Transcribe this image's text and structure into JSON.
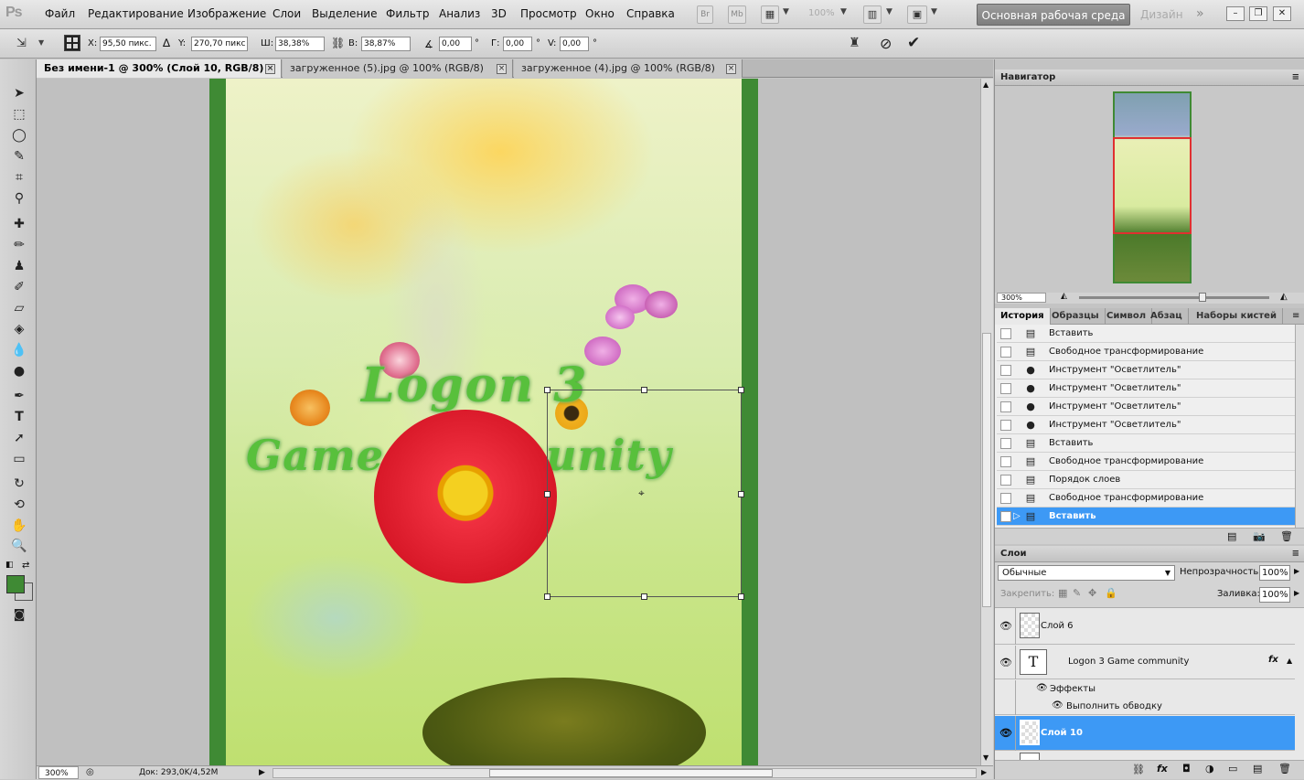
{
  "app": {
    "logo": "Ps"
  },
  "menu": [
    "Файл",
    "Редактирование",
    "Изображение",
    "Слои",
    "Выделение",
    "Фильтр",
    "Анализ",
    "3D",
    "Просмотр",
    "Окно",
    "Справка"
  ],
  "appbar": {
    "zoom": "100%",
    "bridge": "Br",
    "minibridge": "Mb",
    "workspace": "Основная рабочая среда",
    "design": "Дизайн",
    "more": "»"
  },
  "options": {
    "x_label": "X:",
    "x_value": "95,50 пикс.",
    "y_label": "Y:",
    "y_value": "270,70 пикс",
    "w_label": "Ш:",
    "w_value": "38,38%",
    "h_label": "В:",
    "h_value": "38,87%",
    "angle_value": "0,00",
    "angle_unit": "°",
    "hskew_label": "Г:",
    "hskew_value": "0,00",
    "hskew_unit": "°",
    "vskew_label": "V:",
    "vskew_value": "0,00",
    "vskew_unit": "°"
  },
  "tabs": [
    {
      "label": "Без имени-1 @ 300% (Слой 10, RGB/8) *",
      "active": true
    },
    {
      "label": "загруженное (5).jpg @ 100% (RGB/8)",
      "active": false
    },
    {
      "label": "загруженное (4).jpg @ 100% (RGB/8)",
      "active": false
    }
  ],
  "canvas": {
    "line1": "Logon 3",
    "line2": "Game community"
  },
  "status": {
    "zoom": "300%",
    "doc": "Док: 293,0K/4,52M"
  },
  "navigator": {
    "title": "Навигатор",
    "zoom": "300%"
  },
  "history_tabs": [
    "История",
    "Образцы",
    "Символ",
    "Абзац",
    "Наборы кистей"
  ],
  "history": [
    {
      "label": "Вставить",
      "icon": "doc-icon"
    },
    {
      "label": "Свободное трансформирование",
      "icon": "doc-icon"
    },
    {
      "label": "Инструмент \"Осветлитель\"",
      "icon": "dodge-icon"
    },
    {
      "label": "Инструмент \"Осветлитель\"",
      "icon": "dodge-icon"
    },
    {
      "label": "Инструмент \"Осветлитель\"",
      "icon": "dodge-icon"
    },
    {
      "label": "Инструмент \"Осветлитель\"",
      "icon": "dodge-icon"
    },
    {
      "label": "Вставить",
      "icon": "doc-icon"
    },
    {
      "label": "Свободное трансформирование",
      "icon": "doc-icon"
    },
    {
      "label": "Порядок слоев",
      "icon": "doc-icon"
    },
    {
      "label": "Свободное трансформирование",
      "icon": "doc-icon"
    },
    {
      "label": "Вставить",
      "icon": "doc-icon",
      "selected": true
    }
  ],
  "layers": {
    "title": "Слои",
    "blend_mode": "Обычные",
    "opacity_label": "Непрозрачность:",
    "opacity": "100%",
    "lock_label": "Закрепить:",
    "fill_label": "Заливка:",
    "fill": "100%",
    "items": [
      {
        "name": "Слой 6",
        "type": "raster"
      },
      {
        "name": "Logon 3  Game community",
        "type": "text",
        "thumb": "T",
        "fx": "fx"
      },
      {
        "name": "Эффекты",
        "type": "effects"
      },
      {
        "name": "Выполнить обводку",
        "type": "effect"
      },
      {
        "name": "Слой 10",
        "type": "raster",
        "selected": true
      }
    ]
  },
  "colors": {
    "foreground": "#3f8a34",
    "background": "#ffffff",
    "selection": "#3d99f5"
  }
}
